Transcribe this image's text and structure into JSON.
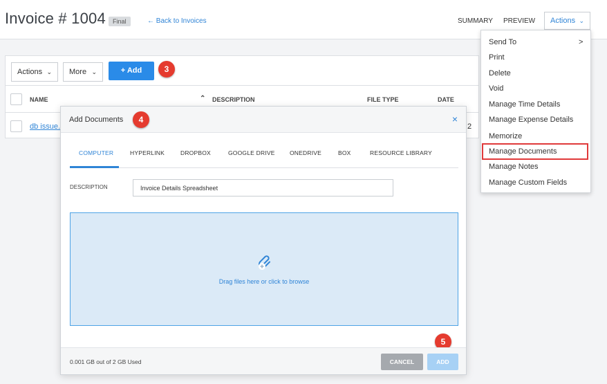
{
  "header": {
    "title": "Invoice # 1004",
    "badge": "Final",
    "back_link": "← Back to Invoices",
    "summary": "SUMMARY",
    "preview": "PREVIEW",
    "actions": "Actions"
  },
  "toolbar": {
    "actions": "Actions",
    "more": "More",
    "add": "+ Add"
  },
  "callouts": {
    "c3": "3",
    "c4": "4",
    "c5": "5"
  },
  "table": {
    "columns": [
      "NAME",
      "DESCRIPTION",
      "FILE TYPE",
      "DATE"
    ],
    "sort_indicator": "^",
    "rows": [
      {
        "name": "db issue.",
        "trailing": "2"
      }
    ]
  },
  "menu": {
    "items": [
      "Send To",
      "Print",
      "Delete",
      "Void",
      "Manage Time Details",
      "Manage Expense Details",
      "Memorize",
      "Manage Documents",
      "Manage Notes",
      "Manage Custom Fields"
    ],
    "submenu_arrow": ">",
    "highlighted": "Manage Documents"
  },
  "modal": {
    "title": "Add Documents",
    "close": "×",
    "tabs": [
      "COMPUTER",
      "HYPERLINK",
      "DROPBOX",
      "GOOGLE DRIVE",
      "ONEDRIVE",
      "BOX",
      "RESOURCE LIBRARY"
    ],
    "active_tab": "COMPUTER",
    "description_label": "DESCRIPTION",
    "description_value": "Invoice Details Spreadsheet",
    "dropzone_text": "Drag files here or click to browse",
    "storage_text": "0.001 GB out of 2 GB Used",
    "cancel": "CANCEL",
    "add": "ADD"
  },
  "colors": {
    "accent": "#2f84d6",
    "primary_button": "#2a8be8",
    "callout": "#e53b2f",
    "highlight_border": "#e0393a",
    "dropzone_bg": "#dbeaf7"
  }
}
